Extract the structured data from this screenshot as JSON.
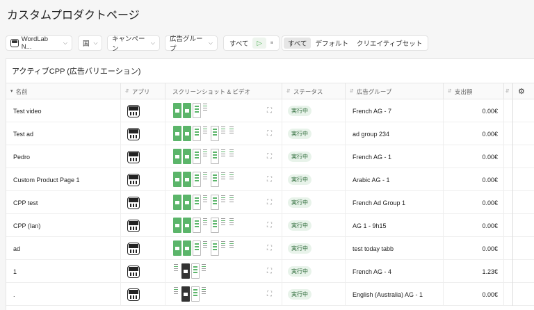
{
  "page": {
    "title": "カスタムプロダクトページ"
  },
  "filters": {
    "app_select": "WordLab N...",
    "country": "国",
    "campaign": "キャンペーン",
    "adgroup": "広告グループ",
    "status_segment": [
      "すべて",
      "▷",
      "⏸"
    ],
    "type_segment": [
      "すべて",
      "デフォルト",
      "クリエイティブセット"
    ]
  },
  "card": {
    "title": "アクティブCPP (広告バリエーション)"
  },
  "table": {
    "columns": [
      "名前",
      "アプリ",
      "スクリーンショット & ビデオ",
      "ステータス",
      "広告グループ",
      "支出額"
    ],
    "rows": [
      {
        "name": "Test video",
        "status": "実行中",
        "ad_group": "French AG - 7",
        "spend": "0.00€",
        "shots": "green"
      },
      {
        "name": "Test ad",
        "status": "実行中",
        "ad_group": "ad group 234",
        "spend": "0.00€",
        "shots": "mixed"
      },
      {
        "name": "Pedro",
        "status": "実行中",
        "ad_group": "French AG - 1",
        "spend": "0.00€",
        "shots": "mixed"
      },
      {
        "name": "Custom Product Page 1",
        "status": "実行中",
        "ad_group": "Arabic AG - 1",
        "spend": "0.00€",
        "shots": "mixed"
      },
      {
        "name": "CPP test",
        "status": "実行中",
        "ad_group": "French Ad Group 1",
        "spend": "0.00€",
        "shots": "mixed"
      },
      {
        "name": "CPP (Ian)",
        "status": "実行中",
        "ad_group": "AG 1 - 9h15",
        "spend": "0.00€",
        "shots": "mixed"
      },
      {
        "name": "ad",
        "status": "実行中",
        "ad_group": "test today tabb",
        "spend": "0.00€",
        "shots": "mixed"
      },
      {
        "name": "1",
        "status": "実行中",
        "ad_group": "French AG - 4",
        "spend": "1.23€",
        "shots": "dark"
      },
      {
        "name": ".",
        "status": "実行中",
        "ad_group": "English (Australia) AG - 1",
        "spend": "0.00€",
        "shots": "dark"
      }
    ]
  }
}
